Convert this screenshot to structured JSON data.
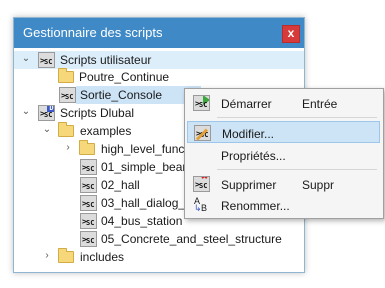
{
  "window": {
    "title": "Gestionnaire des scripts",
    "close_label": "x"
  },
  "tree": {
    "items": [
      {
        "label": "Scripts utilisateur",
        "icon": "script-group-icon",
        "expanded": true
      },
      {
        "label": "Poutre_Continue",
        "icon": "folder-icon"
      },
      {
        "label": "Sortie_Console",
        "icon": "script-icon"
      },
      {
        "label": "Scripts Dlubal",
        "icon": "dlubal-script-group-icon",
        "expanded": true
      },
      {
        "label": "examples",
        "icon": "folder-icon",
        "expanded": true
      },
      {
        "label": "high_level_funct",
        "icon": "folder-icon",
        "expanded": false
      },
      {
        "label": "01_simple_beam",
        "icon": "script-icon"
      },
      {
        "label": "02_hall",
        "icon": "script-icon"
      },
      {
        "label": "03_hall_dialog_in",
        "icon": "script-icon"
      },
      {
        "label": "04_bus_station",
        "icon": "script-icon"
      },
      {
        "label": "05_Concrete_and_steel_structure",
        "icon": "script-icon"
      },
      {
        "label": "includes",
        "icon": "folder-icon",
        "expanded": false
      }
    ]
  },
  "context_menu": {
    "items": [
      {
        "label": "Démarrer",
        "shortcut": "Entrée",
        "icon": "run-script-icon"
      },
      {
        "label": "Modifier...",
        "shortcut": "",
        "icon": "edit-script-icon"
      },
      {
        "label": "Propriétés...",
        "shortcut": "",
        "icon": ""
      },
      {
        "label": "Supprimer",
        "shortcut": "Suppr",
        "icon": "delete-script-icon"
      },
      {
        "label": "Renommer...",
        "shortcut": "",
        "icon": "rename-icon"
      }
    ]
  },
  "colors": {
    "title_bar": "#3f8ac6",
    "close_button": "#d63a3a",
    "selection": "#cde4f7"
  }
}
